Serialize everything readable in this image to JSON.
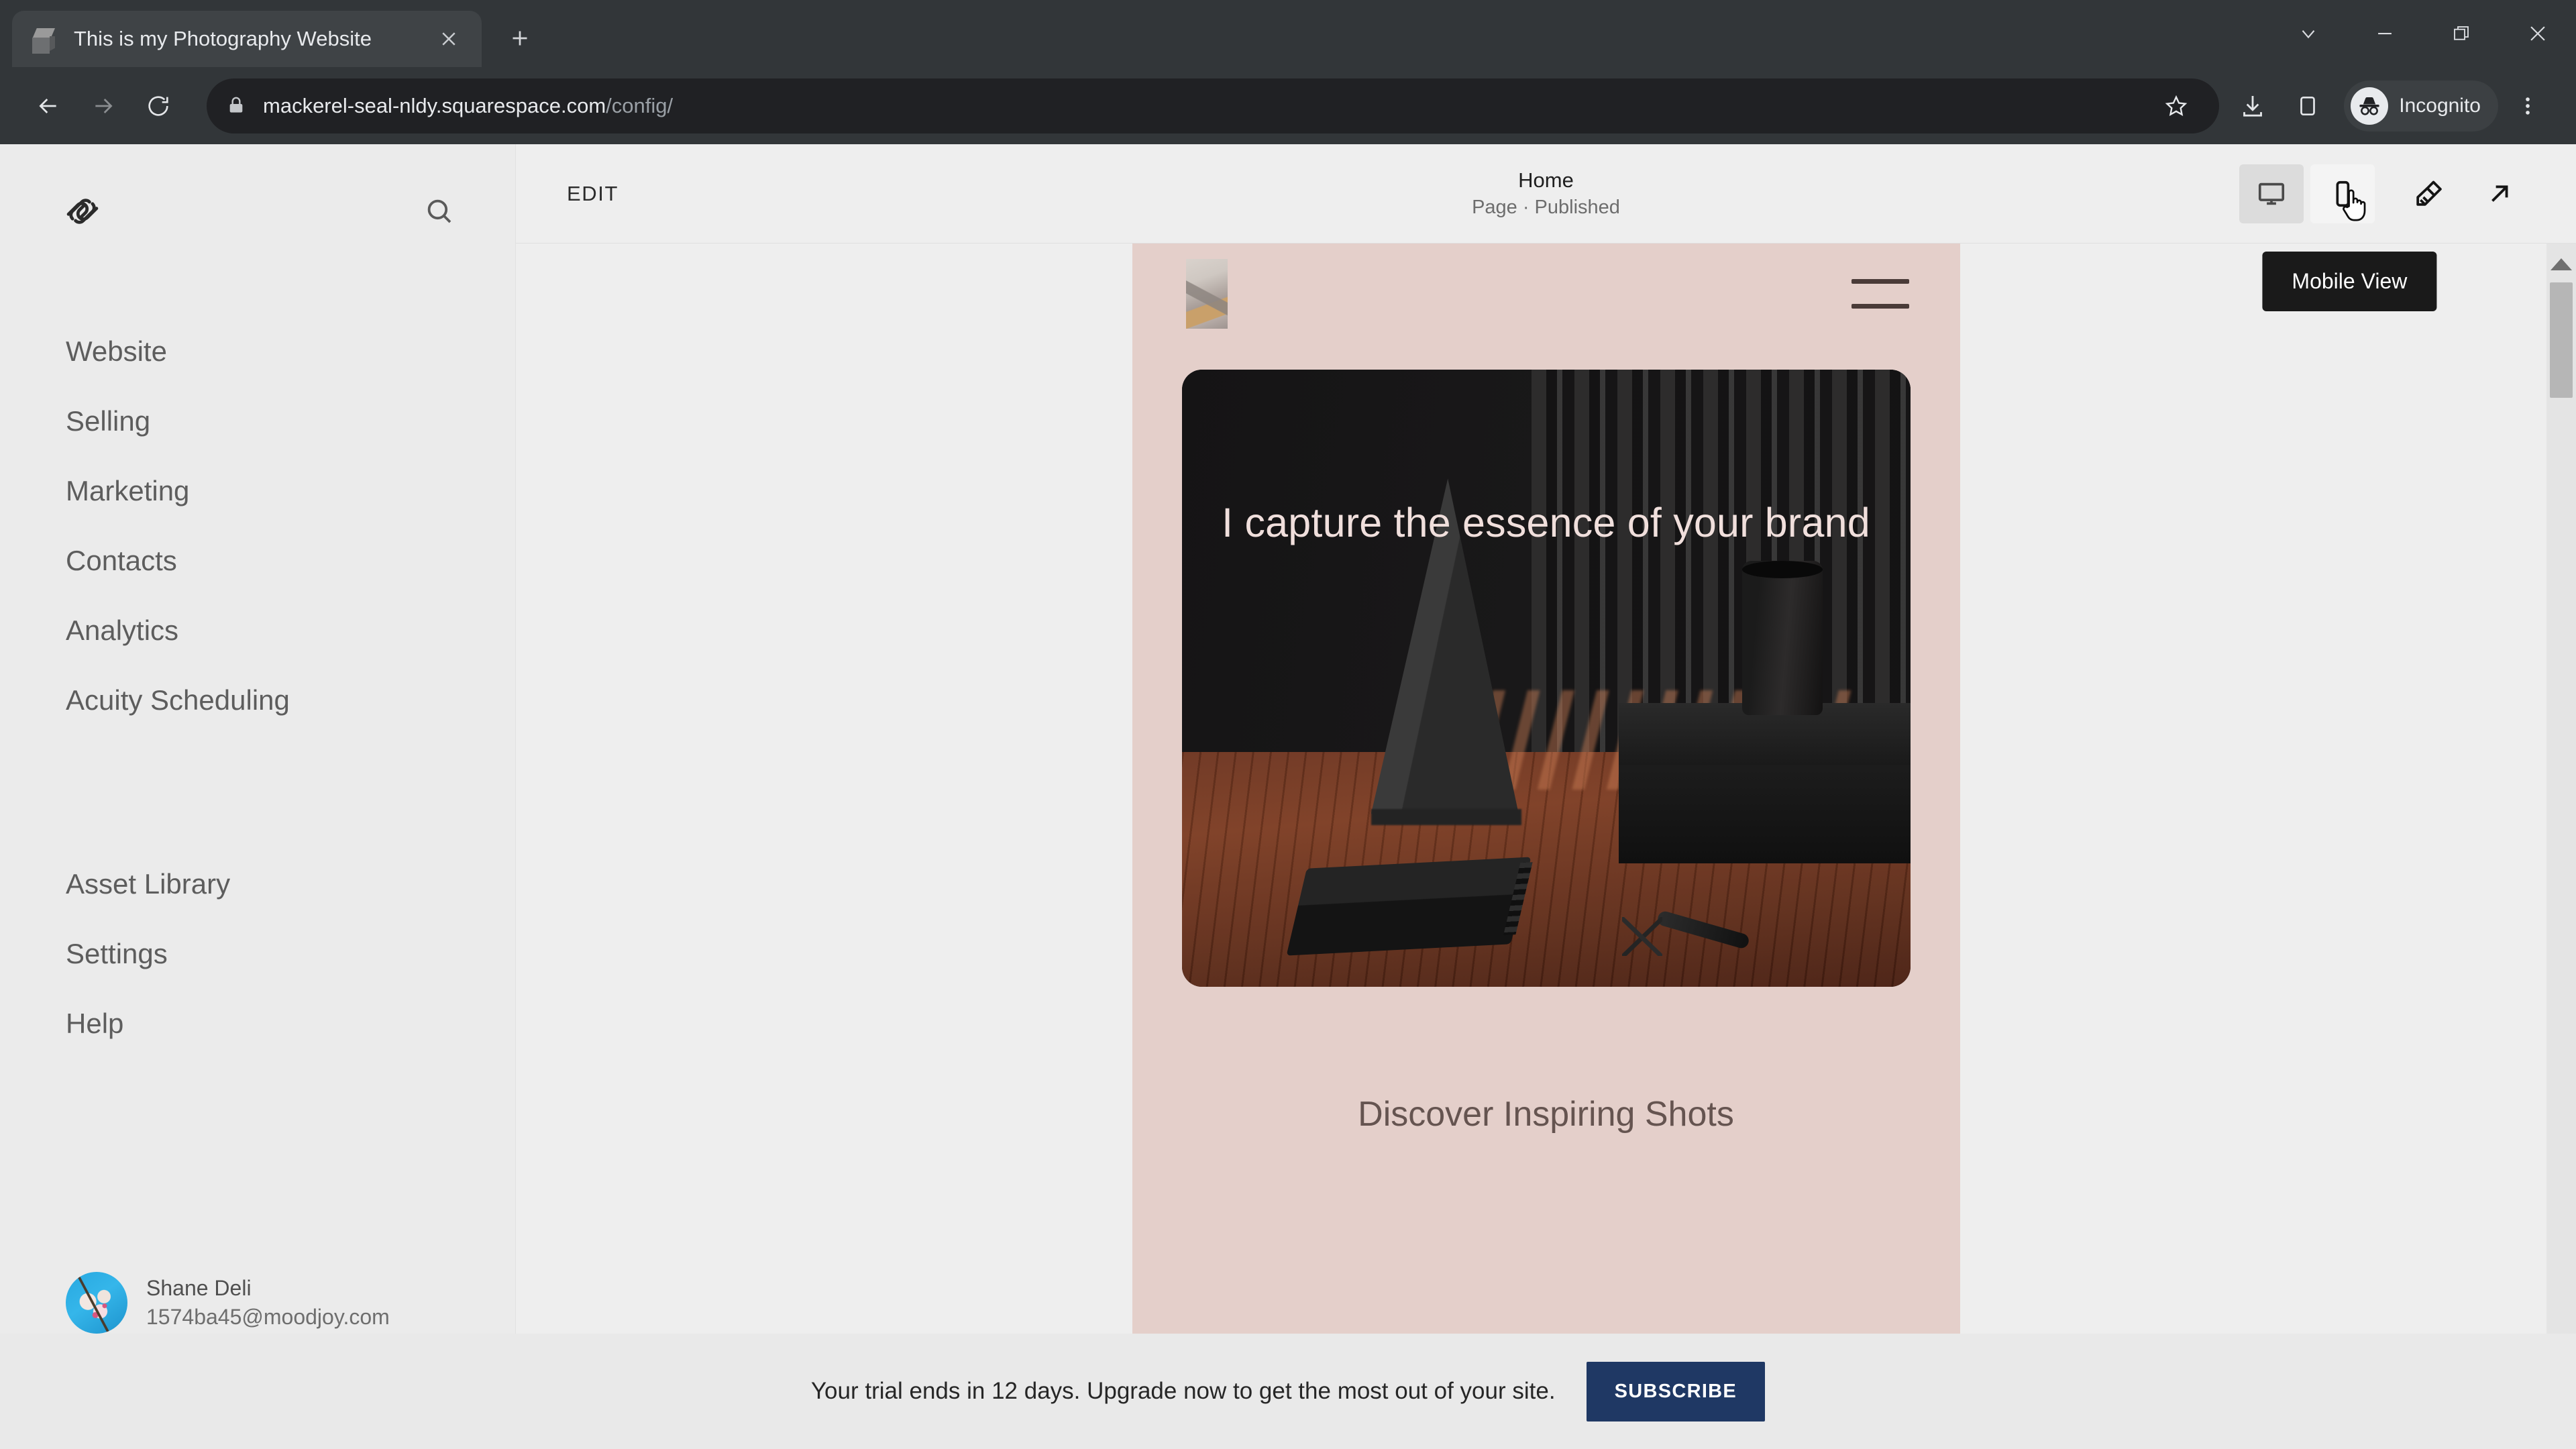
{
  "browser": {
    "tab": {
      "title": "This is my Photography Website",
      "favicon": "cube-icon",
      "close_label": "×"
    },
    "new_tab_label": "+",
    "window_controls": {
      "tab_search": "chevron-down-icon",
      "minimize": "minimize-icon",
      "maximize": "maximize-icon",
      "close": "close-icon"
    },
    "nav": {
      "back": "back-arrow-icon",
      "forward": "forward-arrow-icon",
      "reload": "reload-icon"
    },
    "omnibox": {
      "lock": "lock-icon",
      "url_host": "mackerel-seal-nldy.squarespace.com",
      "url_path": "/config/",
      "bookmark": "star-icon"
    },
    "actions": {
      "downloads": "download-icon",
      "side_panel": "side-panel-icon",
      "profile_label": "Incognito",
      "profile_icon": "incognito-icon",
      "menu": "three-dot-menu-icon"
    }
  },
  "sidebar": {
    "logo": "squarespace-logo",
    "search_icon": "search-icon",
    "primary_items": [
      {
        "label": "Website"
      },
      {
        "label": "Selling"
      },
      {
        "label": "Marketing"
      },
      {
        "label": "Contacts"
      },
      {
        "label": "Analytics"
      },
      {
        "label": "Acuity Scheduling"
      }
    ],
    "secondary_items": [
      {
        "label": "Asset Library"
      },
      {
        "label": "Settings"
      },
      {
        "label": "Help"
      }
    ],
    "user": {
      "name": "Shane Deli",
      "email": "1574ba45@moodjoy.com",
      "avatar": "user-avatar"
    }
  },
  "main": {
    "edit_label": "EDIT",
    "page_title": "Home",
    "page_status": "Page · Published",
    "view_tools": [
      {
        "name": "desktop-view",
        "icon": "monitor-icon",
        "state": "active"
      },
      {
        "name": "mobile-view",
        "icon": "phone-icon",
        "state": "hovered"
      },
      {
        "name": "site-styles",
        "icon": "paintbrush-icon",
        "state": "default"
      },
      {
        "name": "open-in-new-tab",
        "icon": "arrow-up-right-icon",
        "state": "default"
      }
    ],
    "tooltip": "Mobile View"
  },
  "preview": {
    "site_logo": "site-logo-image",
    "menu_icon": "hamburger-menu-icon",
    "hero_heading": "I capture the essence of your brand",
    "hero_image": "dark-studio-scene-with-pyramid",
    "section_heading": "Discover Inspiring Shots",
    "background_color": "#e4cfca",
    "scrollbar": {
      "up_arrow": "scroll-up-arrow-icon"
    }
  },
  "trial_banner": {
    "message": "Your trial ends in 12 days. Upgrade now to get the most out of your site.",
    "subscribe_label": "SUBSCRIBE",
    "subscribe_color": "#1f3864"
  }
}
